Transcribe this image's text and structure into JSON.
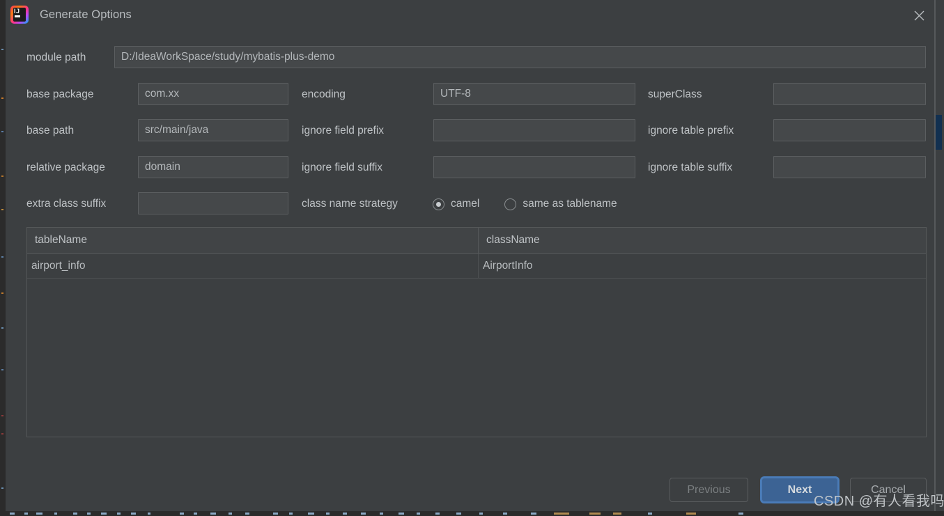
{
  "window": {
    "title": "Generate Options",
    "logo_icon": "intellij-idea-icon",
    "close_icon": "close-icon"
  },
  "form": {
    "module_path": {
      "label": "module path",
      "value": "D:/IdeaWorkSpace/study/mybatis-plus-demo"
    },
    "base_package": {
      "label": "base package",
      "value": "com.xx"
    },
    "encoding": {
      "label": "encoding",
      "value": "UTF-8"
    },
    "super_class": {
      "label": "superClass",
      "value": ""
    },
    "base_path": {
      "label": "base path",
      "value": "src/main/java"
    },
    "ignore_field_prefix": {
      "label": "ignore field prefix",
      "value": ""
    },
    "ignore_table_prefix": {
      "label": "ignore table prefix",
      "value": ""
    },
    "relative_package": {
      "label": "relative package",
      "value": "domain"
    },
    "ignore_field_suffix": {
      "label": "ignore field suffix",
      "value": ""
    },
    "ignore_table_suffix": {
      "label": "ignore table suffix",
      "value": ""
    },
    "extra_class_suffix": {
      "label": "extra class suffix",
      "value": ""
    },
    "class_name_strategy": {
      "label": "class name strategy",
      "options": [
        {
          "label": "camel",
          "selected": true
        },
        {
          "label": "same as tablename",
          "selected": false
        }
      ]
    }
  },
  "table": {
    "columns": [
      "tableName",
      "className"
    ],
    "rows": [
      {
        "tableName": "airport_info",
        "className": "AirportInfo"
      }
    ]
  },
  "buttons": {
    "previous": "Previous",
    "next": "Next",
    "cancel": "Cancel"
  },
  "watermark": {
    "text": "CSDN @有人看我吗"
  },
  "colors": {
    "dialog_bg": "#3c3f41",
    "field_bg": "#45484a",
    "field_border": "#5b5e60",
    "text": "#bfc3c6",
    "primary_button": "#3c6394",
    "scrollbar_thumb": "#123050"
  }
}
